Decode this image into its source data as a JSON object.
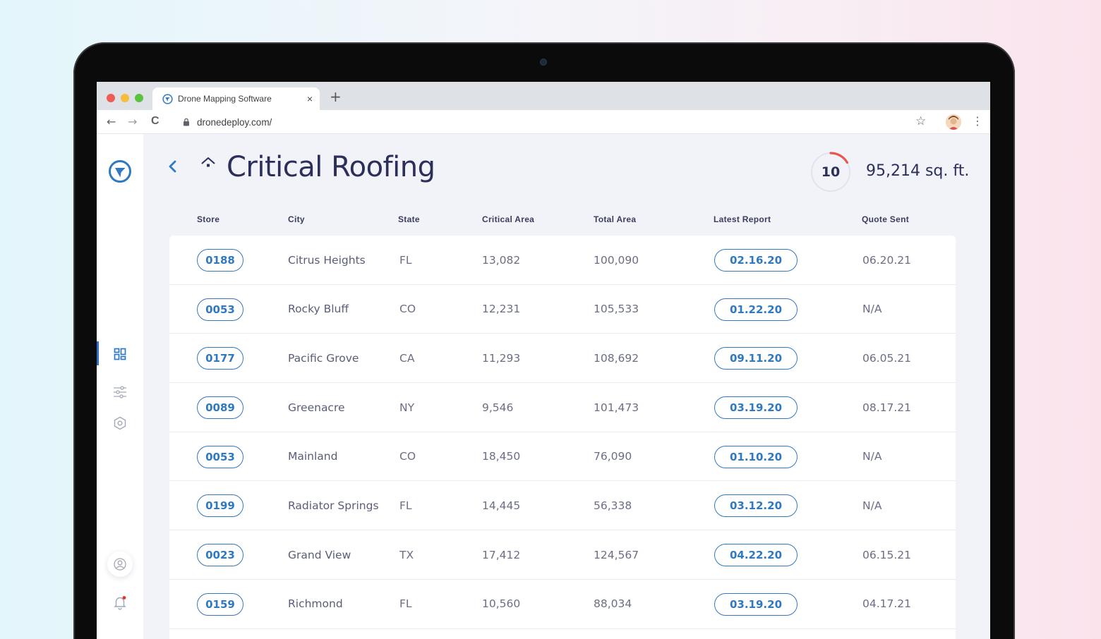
{
  "browser": {
    "tab_title": "Drone Mapping Software",
    "tab_close": "×",
    "new_tab": "+",
    "url": "dronedeploy.com/",
    "back": "←",
    "forward": "→",
    "reload": "C",
    "star": "☆",
    "menu": "⋮"
  },
  "header": {
    "title": "Critical Roofing",
    "count": "10",
    "total_area": "95,214 sq. ft."
  },
  "table": {
    "columns": [
      "Store",
      "City",
      "State",
      "Critical Area",
      "Total Area",
      "Latest Report",
      "Quote Sent"
    ],
    "rows": [
      {
        "store": "0188",
        "city": "Citrus Heights",
        "state": "FL",
        "critical": "13,082",
        "total": "100,090",
        "report": "02.16.20",
        "quote": "06.20.21"
      },
      {
        "store": "0053",
        "city": "Rocky Bluff",
        "state": "CO",
        "critical": "12,231",
        "total": "105,533",
        "report": "01.22.20",
        "quote": "N/A"
      },
      {
        "store": "0177",
        "city": "Pacific Grove",
        "state": "CA",
        "critical": "11,293",
        "total": "108,692",
        "report": "09.11.20",
        "quote": "06.05.21"
      },
      {
        "store": "0089",
        "city": "Greenacre",
        "state": "NY",
        "critical": "9,546",
        "total": "101,473",
        "report": "03.19.20",
        "quote": "08.17.21"
      },
      {
        "store": "0053",
        "city": "Mainland",
        "state": "CO",
        "critical": "18,450",
        "total": "76,090",
        "report": "01.10.20",
        "quote": "N/A"
      },
      {
        "store": "0199",
        "city": "Radiator Springs",
        "state": "FL",
        "critical": "14,445",
        "total": "56,338",
        "report": "03.12.20",
        "quote": "N/A"
      },
      {
        "store": "0023",
        "city": "Grand View",
        "state": "TX",
        "critical": "17,412",
        "total": "124,567",
        "report": "04.22.20",
        "quote": "06.15.21"
      },
      {
        "store": "0159",
        "city": "Richmond",
        "state": "FL",
        "critical": "10,560",
        "total": "88,034",
        "report": "03.19.20",
        "quote": "04.17.21"
      }
    ]
  },
  "colors": {
    "accent": "#2f79c2",
    "ring_progress": "#e8564f",
    "title": "#2c2f5a"
  },
  "icons": [
    "logo-icon",
    "dashboard-icon",
    "filters-icon",
    "settings-icon",
    "user-icon",
    "notification-icon",
    "home-icon",
    "back-icon"
  ]
}
